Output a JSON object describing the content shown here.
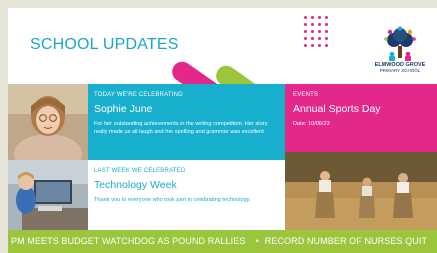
{
  "header": {
    "title": "SCHOOL UPDATES"
  },
  "logo": {
    "name": "ELMWOOD GROVE",
    "sub": "PRIMARY SCHOOL"
  },
  "celebrating": {
    "kicker": "TODAY WE'RE CELEBRATING",
    "name": "Sophie June",
    "body": "For her outstanding achievements in the writing competition. Her story really made us all laugh and her spelling and grammar was excellent"
  },
  "last_week": {
    "kicker": "LAST WEEK WE CELEBRATED",
    "title": "Technology Week",
    "body": "Thank you to everyone who took part in celebrating technology."
  },
  "events": {
    "kicker": "EVENTS",
    "title": "Annual Sports Day",
    "date": "Date: 10/06/23"
  },
  "ticker": {
    "item1": "PM MEETS BUDGET WATCHDOG AS POUND RALLIES",
    "separator": "•",
    "item2": "RECORD NUMBER OF NURSES QUIT"
  },
  "colors": {
    "blue": "#18aecd",
    "pink": "#e3278b",
    "green": "#9bc53d"
  }
}
